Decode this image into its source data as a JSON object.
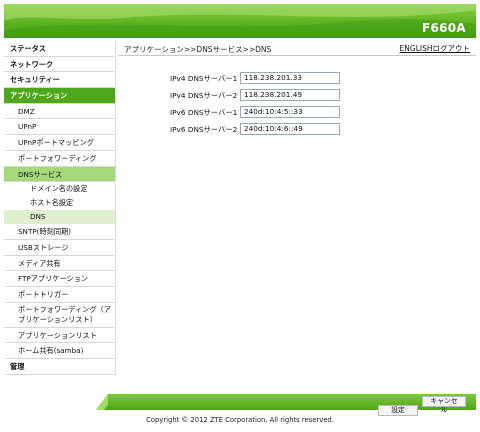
{
  "header": {
    "model": "F660A"
  },
  "sidebar": {
    "items": [
      {
        "label": "ステータス"
      },
      {
        "label": "ネットワーク"
      },
      {
        "label": "セキュリティー"
      },
      {
        "label": "アプリケーション"
      },
      {
        "label": "DMZ"
      },
      {
        "label": "UPnP"
      },
      {
        "label": "UPnPポートマッピング"
      },
      {
        "label": "ポートフォワーディング"
      },
      {
        "label": "DNSサービス"
      },
      {
        "label": "ドメイン名の設定"
      },
      {
        "label": "ホスト名設定"
      },
      {
        "label": "DNS"
      },
      {
        "label": "SNTP(時刻同期)"
      },
      {
        "label": "USBストレージ"
      },
      {
        "label": "メディア共有"
      },
      {
        "label": "FTPアプリケーション"
      },
      {
        "label": "ポートトリガー"
      },
      {
        "label": "ポートフォワーディング（アプリケーションリスト）"
      },
      {
        "label": "アプリケーションリスト"
      },
      {
        "label": "ホーム共有(samba)"
      },
      {
        "label": "管理"
      }
    ]
  },
  "main": {
    "breadcrumb": "アプリケーション>>DNSサービス>>DNS",
    "lang_link": "ENGLISH",
    "logout_link": "ログアウト",
    "fields": [
      {
        "label": "IPv4 DNSサーバー1",
        "value": "118.238.201.33"
      },
      {
        "label": "IPv4 DNSサーバー2",
        "value": "118.238.201.49"
      },
      {
        "label": "IPv6 DNSサーバー1",
        "value": "240d:10:4:5::33"
      },
      {
        "label": "IPv6 DNSサーバー2",
        "value": "240d:10:4:6::49"
      }
    ]
  },
  "footer": {
    "save_label": "設定",
    "cancel_label": "キャンセル",
    "copyright": "Copyright © 2012 ZTE Corporation. All rights reserved."
  },
  "colors": {
    "brand_green": "#4da61b",
    "active_sub": "#a6d97a",
    "active_subsub": "#dff0cf"
  }
}
